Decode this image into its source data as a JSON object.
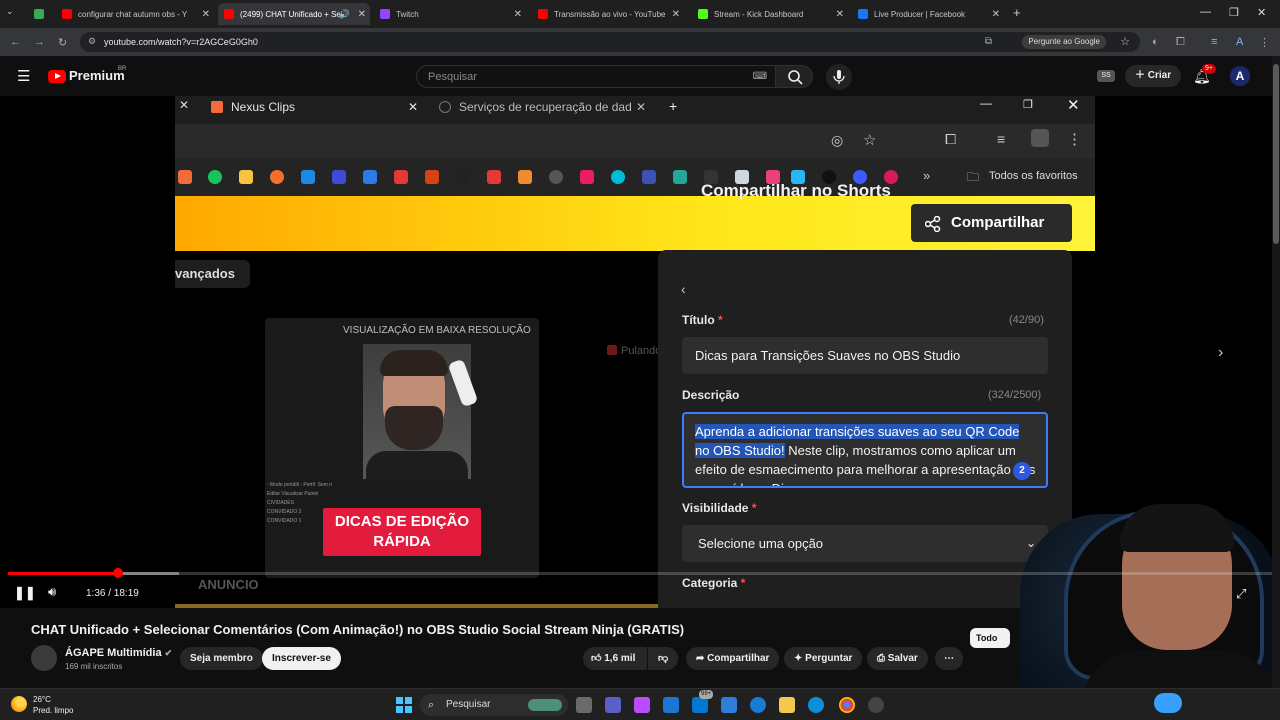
{
  "browser": {
    "tabs": [
      {
        "title": "",
        "favicon": "#c89ad8"
      },
      {
        "title": "configurar chat autumn obs - Y",
        "favicon": "#ff0000"
      },
      {
        "title": "(2499) CHAT Unificado + Se",
        "favicon": "#ff0000",
        "active": true
      },
      {
        "title": "Twitch",
        "favicon": "#9146ff"
      },
      {
        "title": "Transmissão ao vivo - YouTube",
        "favicon": "#ff0000"
      },
      {
        "title": "Stream - Kick Dashboard",
        "favicon": "#53fc18"
      },
      {
        "title": "Live Producer | Facebook",
        "favicon": "#1877f2"
      }
    ],
    "url": "youtube.com/watch?v=r2AGCeG0Gh0",
    "ask_google": "Pergunte ao Google"
  },
  "youtube": {
    "logo_text": "Premium",
    "logo_region": "BR",
    "search_placeholder": "Pesquisar",
    "avatar_initials": "SS",
    "create_label": "Criar",
    "notif_count": "9+",
    "account_initial": "A"
  },
  "video_content": {
    "inner_tabs": [
      "Nexus Clips",
      "Serviços de recuperação de dad"
    ],
    "bookmarks_label": "Todos os favoritos",
    "share_button": "Compartilhar",
    "avancados": "vançados",
    "thumb_label": "VISUALIZAÇÃO EM BAIXA RESOLUÇÃO",
    "dicas_line1": "DICAS DE EDIÇÃO",
    "dicas_line2": "RÁPIDA",
    "pulando": "Pulando",
    "anuncio": "ANUNCIO",
    "panel": {
      "title": "Compartilhar no Shorts",
      "titulo_label": "Título",
      "titulo_count": "(42/90)",
      "titulo_value": "Dicas para Transições Suaves no OBS Studio",
      "descricao_label": "Descrição",
      "descricao_count": "(324/2500)",
      "descricao_selected": "Aprenda a adicionar transições suaves ao seu QR Code no OBS Studio!",
      "descricao_rest": " Neste clip, mostramos como aplicar um efeito de esmaecimento para melhorar a apresentação dos seus vídeos. Dica:",
      "badge": "2",
      "visibilidade_label": "Visibilidade",
      "visibilidade_value": "Selecione uma opção",
      "categoria_label": "Categoria",
      "required_mark": "*"
    }
  },
  "player": {
    "time": "1:36 / 18:19",
    "progress_played": 0.0873,
    "progress_loaded": 0.135
  },
  "info": {
    "title": "CHAT Unificado + Selecionar Comentários (Com Animação!) no OBS Studio Social Stream Ninja (GRATIS)",
    "channel": "ÁGAPE Multimídia",
    "subscribers": "169 mil inscritos",
    "join_label": "Seja membro",
    "subscribe_label": "Inscrever-se",
    "likes": "1,6 mil",
    "share_label": "Compartilhar",
    "ask_label": "Perguntar",
    "save_label": "Salvar",
    "filter_chip": "Todo"
  },
  "taskbar": {
    "temperature": "26°C",
    "weather": "Pred. limpo",
    "search": "Pesquisar",
    "badge": "99+"
  }
}
